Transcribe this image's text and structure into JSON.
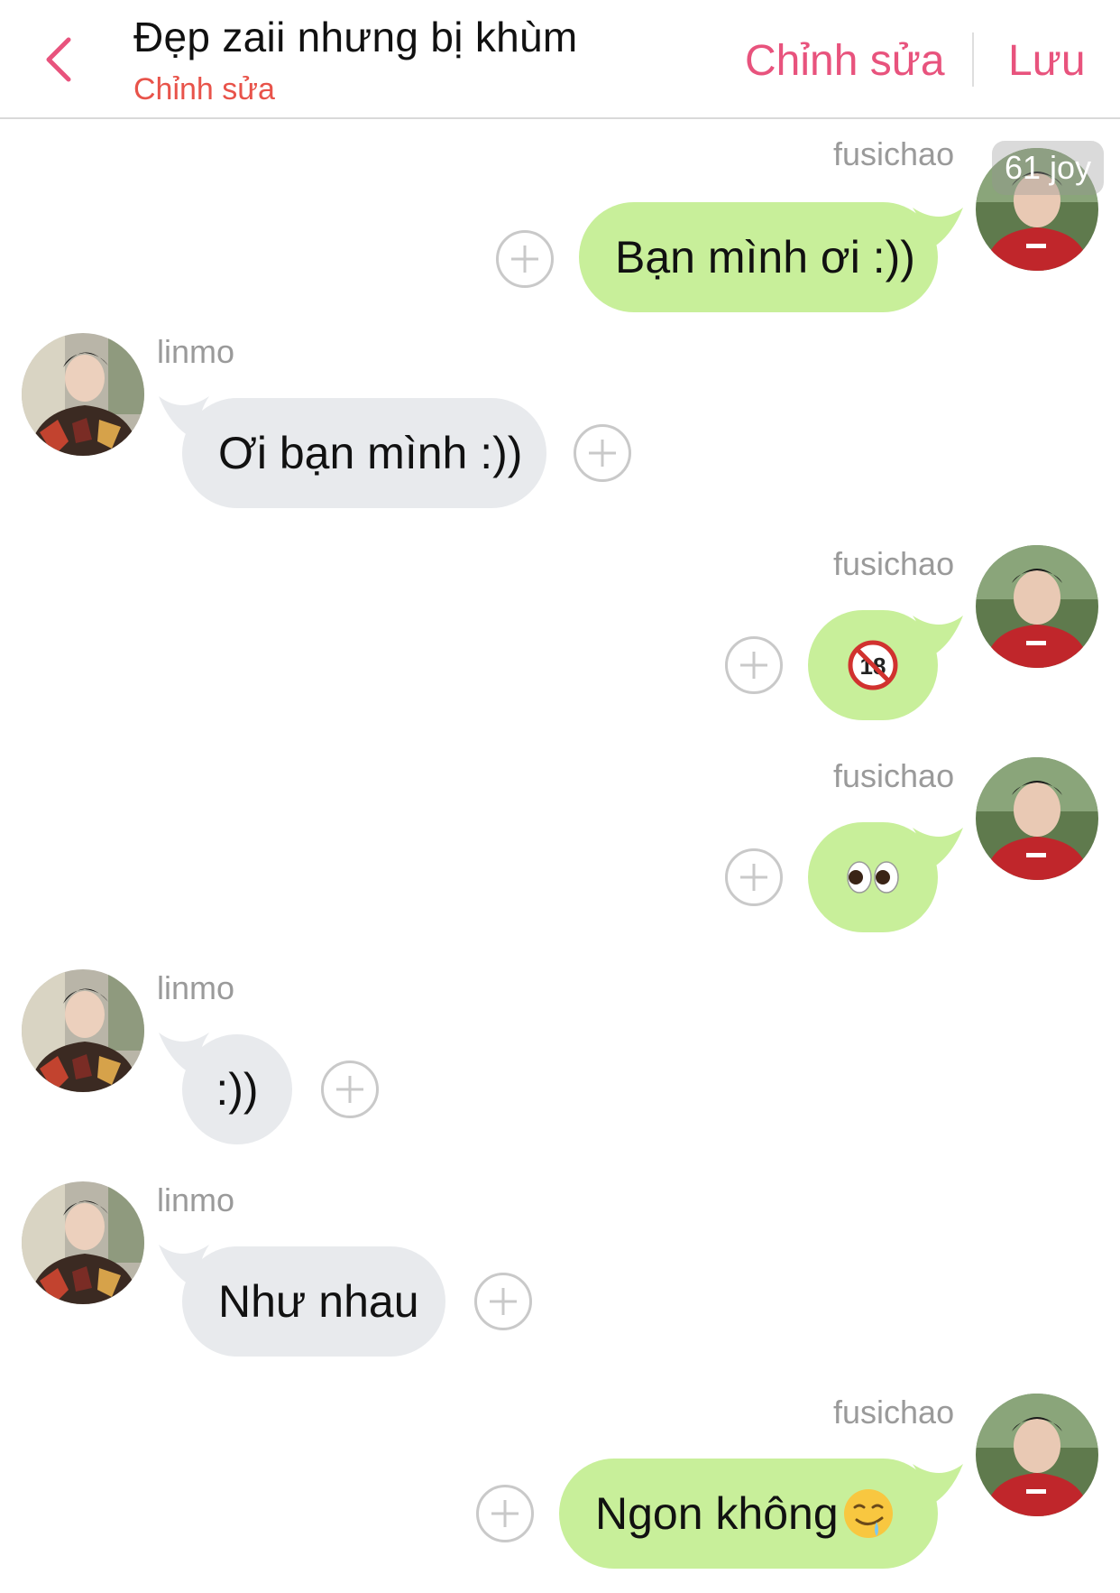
{
  "header": {
    "title": "Đẹp zaii nhưng bị khùm",
    "subtitle": "Chỉnh sửa",
    "edit_label": "Chỉnh sửa",
    "save_label": "Lưu"
  },
  "badge": "61 joy",
  "messages": [
    {
      "sender": "fusichao",
      "side": "right",
      "text": "Bạn mình ơi :))"
    },
    {
      "sender": "linmo",
      "side": "left",
      "text": "Ơi bạn mình :))"
    },
    {
      "sender": "fusichao",
      "side": "right",
      "text": "",
      "emoji": "no-under-18-emoji"
    },
    {
      "sender": "fusichao",
      "side": "right",
      "text": "",
      "emoji": "eyes-emoji"
    },
    {
      "sender": "linmo",
      "side": "left",
      "text": ":))"
    },
    {
      "sender": "linmo",
      "side": "left",
      "text": "Như nhau"
    },
    {
      "sender": "fusichao",
      "side": "right",
      "text": "Ngon không",
      "emoji": "drooling-face-emoji"
    }
  ],
  "colors": {
    "accent": "#e8537d",
    "subtitle": "#e8534a",
    "outgoing_bubble": "#c8ef9a",
    "incoming_bubble": "#e8eaed"
  }
}
